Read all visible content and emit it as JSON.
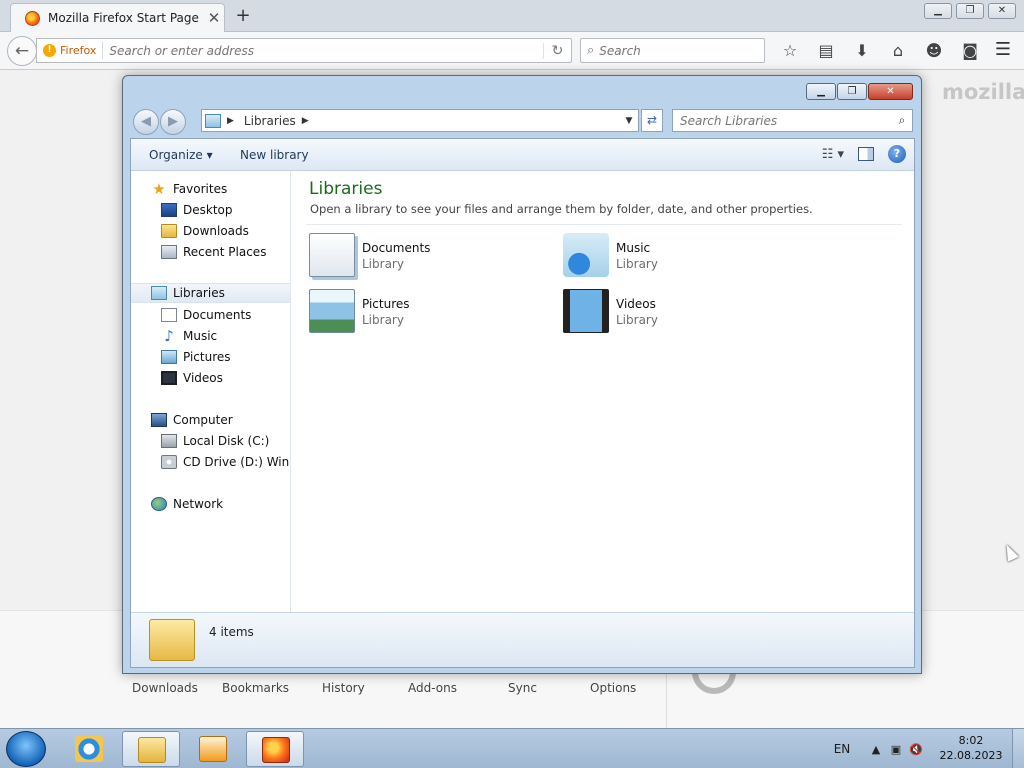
{
  "firefox": {
    "tab_title": "Mozilla Firefox Start Page",
    "identity_label": "Firefox",
    "url_placeholder": "Search or enter address",
    "search_placeholder": "Search",
    "page_logo_text": "mozilla",
    "launchers": [
      "Downloads",
      "Bookmarks",
      "History",
      "Add-ons",
      "Sync",
      "Options"
    ]
  },
  "explorer": {
    "breadcrumb": [
      "Libraries"
    ],
    "search_placeholder": "Search Libraries",
    "toolbar": {
      "organize": "Organize",
      "new_library": "New library"
    },
    "nav": {
      "favorites": {
        "label": "Favorites",
        "items": [
          "Desktop",
          "Downloads",
          "Recent Places"
        ]
      },
      "libraries": {
        "label": "Libraries",
        "items": [
          "Documents",
          "Music",
          "Pictures",
          "Videos"
        ]
      },
      "computer": {
        "label": "Computer",
        "items": [
          "Local Disk (C:)",
          "CD Drive (D:) Windo"
        ]
      },
      "network": {
        "label": "Network"
      }
    },
    "content": {
      "title": "Libraries",
      "subtitle": "Open a library to see your files and arrange them by folder, date, and other properties.",
      "items": [
        {
          "name": "Documents",
          "kind": "Library",
          "icon": "documents-library-icon"
        },
        {
          "name": "Music",
          "kind": "Library",
          "icon": "music-library-icon"
        },
        {
          "name": "Pictures",
          "kind": "Library",
          "icon": "pictures-library-icon"
        },
        {
          "name": "Videos",
          "kind": "Library",
          "icon": "videos-library-icon"
        }
      ]
    },
    "details": {
      "count": "4 items"
    }
  },
  "taskbar": {
    "language": "EN",
    "time": "8:02",
    "date": "22.08.2023"
  },
  "colors": {
    "libraries_title": "#1e6b1e",
    "explorer_frame": "#bcd3ec",
    "close_button": "#c5412d"
  }
}
